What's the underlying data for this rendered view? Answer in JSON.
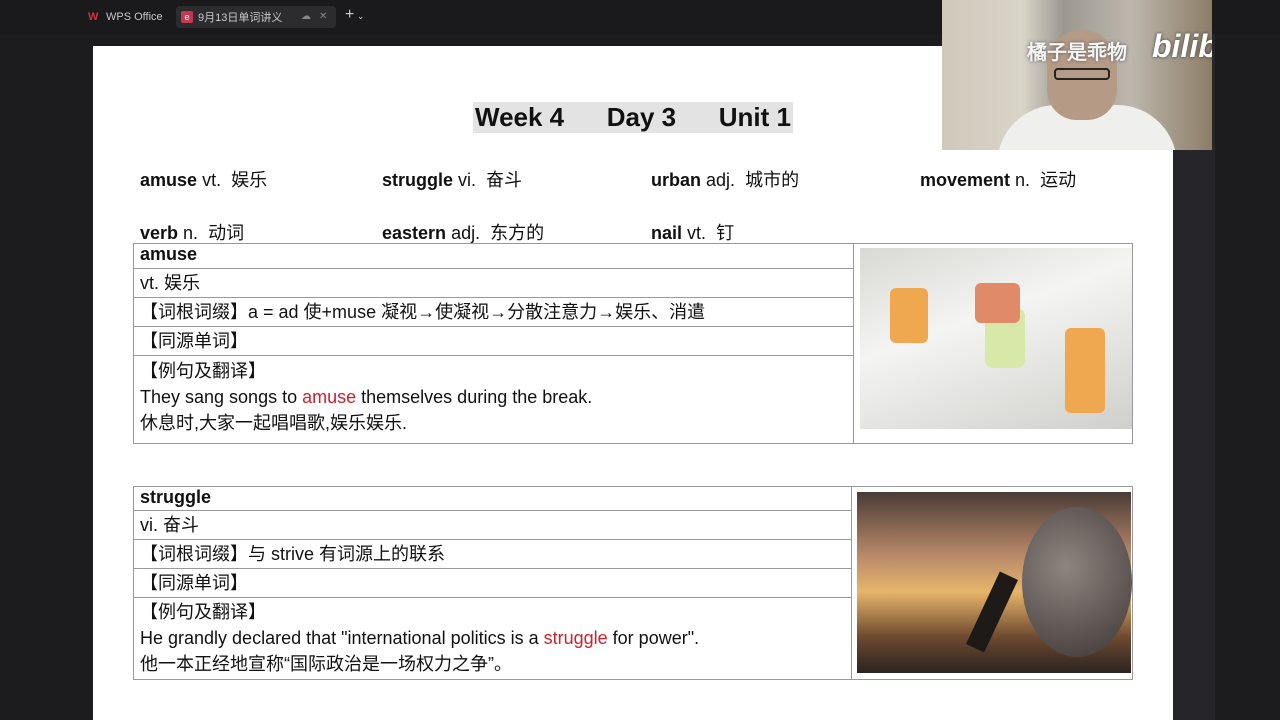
{
  "titlebar": {
    "app_tab": "WPS Office",
    "doc_tab": "9月13日单词讲义",
    "new_tab": "+"
  },
  "header": {
    "week": "Week 4",
    "day": "Day 3",
    "unit": "Unit 1"
  },
  "words": [
    {
      "word": "amuse",
      "pos": "vt.",
      "meaning": "娱乐"
    },
    {
      "word": "struggle",
      "pos": "vi.",
      "meaning": "奋斗"
    },
    {
      "word": "urban",
      "pos": "adj.",
      "meaning": "城市的"
    },
    {
      "word": "movement",
      "pos": "n.",
      "meaning": "运动"
    },
    {
      "word": "verb",
      "pos": "n.",
      "meaning": "动词"
    },
    {
      "word": "eastern",
      "pos": "adj.",
      "meaning": "东方的"
    },
    {
      "word": "nail",
      "pos": "vt.",
      "meaning": "钉"
    }
  ],
  "cards": [
    {
      "word": "amuse",
      "definition": "vt.  娱乐",
      "roots": "【词根词缀】a = ad 使+muse 凝视→使凝视→分散注意力→娱乐、消遣",
      "cognates": "【同源单词】",
      "example_label": "【例句及翻译】",
      "example_before": "They sang songs to ",
      "example_key": "amuse",
      "example_after": " themselves during the break.",
      "translation": "休息时,大家一起唱唱歌,娱乐娱乐."
    },
    {
      "word": "struggle",
      "definition": "vi.  奋斗",
      "roots": "【词根词缀】与  strive  有词源上的联系",
      "cognates": "【同源单词】",
      "example_label": "【例句及翻译】",
      "example_before": "He grandly declared that \"international politics is a ",
      "example_key": "struggle",
      "example_after": " for power\".",
      "translation": "他一本正经地宣称“国际政治是一场权力之争”。"
    }
  ],
  "overlay": {
    "streamer": "橘子是乖物",
    "platform": "bilibili"
  }
}
